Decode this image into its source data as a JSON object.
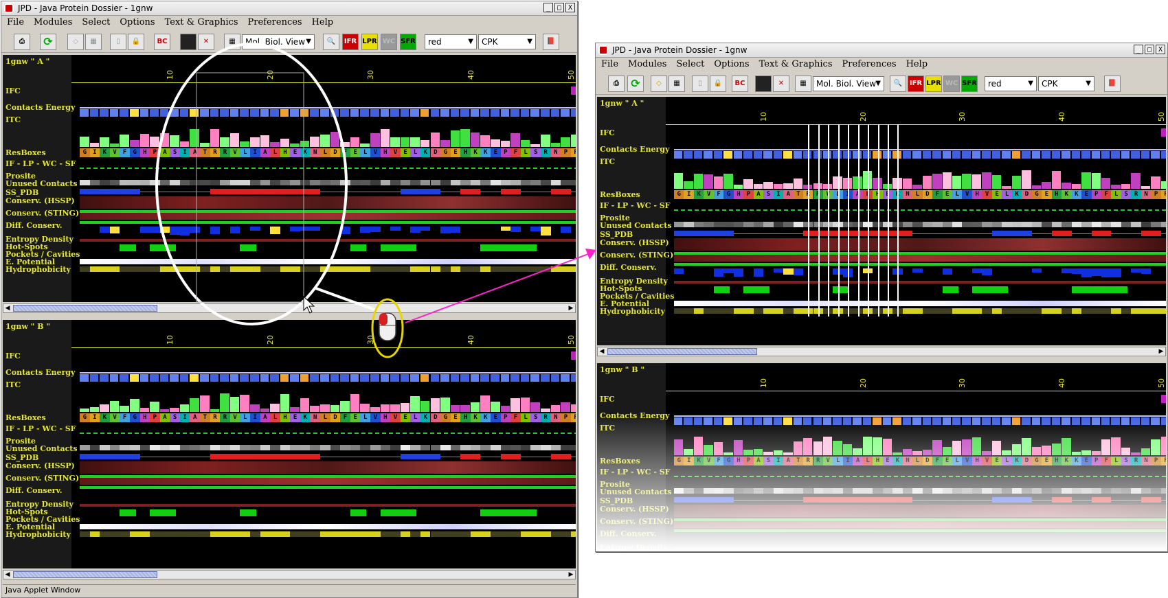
{
  "window_left": {
    "title": "JPD - Java Protein Dossier - 1gnw",
    "status": "Java Applet Window"
  },
  "window_right": {
    "title": "JPD - Java Protein Dossier - 1gnw"
  },
  "window_buttons": {
    "min": "_",
    "max": "□",
    "close": "X"
  },
  "menu": [
    "File",
    "Modules",
    "Select",
    "Options",
    "Text & Graphics",
    "Preferences",
    "Help"
  ],
  "toolbar": {
    "view_select": "Mol. Biol. View",
    "color_select": "red",
    "style_select": "CPK",
    "btn_bc": "BC",
    "btn_ifr": "IFR",
    "btn_lpr": "LPR",
    "btn_wc": "WC",
    "btn_sfr": "SFR"
  },
  "chain_a_label": "1gnw \" A \"",
  "chain_b_label": "1gnw \" B \"",
  "ruler_ticks": [
    "10",
    "20",
    "30",
    "40",
    "50"
  ],
  "sequence": "GIKVFGHPASIATRRVLIALHEKNLDFELVHVELKDGEHKKEPFLSRNPFG",
  "tracks": {
    "ifc": "IFC",
    "contacts_energy": "Contacts Energy",
    "itc": "ITC",
    "resboxes": "ResBoxes",
    "if_lp_wc_sf": "IF - LP - WC - SF",
    "prosite": "Prosite",
    "unused_contacts": "Unused Contacts",
    "ss_pdb": "SS_PDB",
    "conserv_hssp": "Conserv. (HSSP)",
    "conserv_sting": "Conserv. (STING)",
    "diff_conserv": "Diff. Conserv.",
    "entropy_density": "Entropy Density",
    "hot_spots": "Hot-Spots",
    "pockets": "Pockets / Cavities",
    "e_potential": "E. Potential",
    "hydrophobicity": "Hydrophobicity"
  },
  "colors": {
    "label_yellow": "#e6e635",
    "ellipse": "#ffffff",
    "mouse_ring": "#e8d400",
    "arrow": "#ff22cc"
  },
  "icons": [
    "print-icon",
    "refresh-icon",
    "eraser-icon",
    "table-icon",
    "lock-icon",
    "search-icon",
    "book-icon",
    "mouse-icon"
  ]
}
